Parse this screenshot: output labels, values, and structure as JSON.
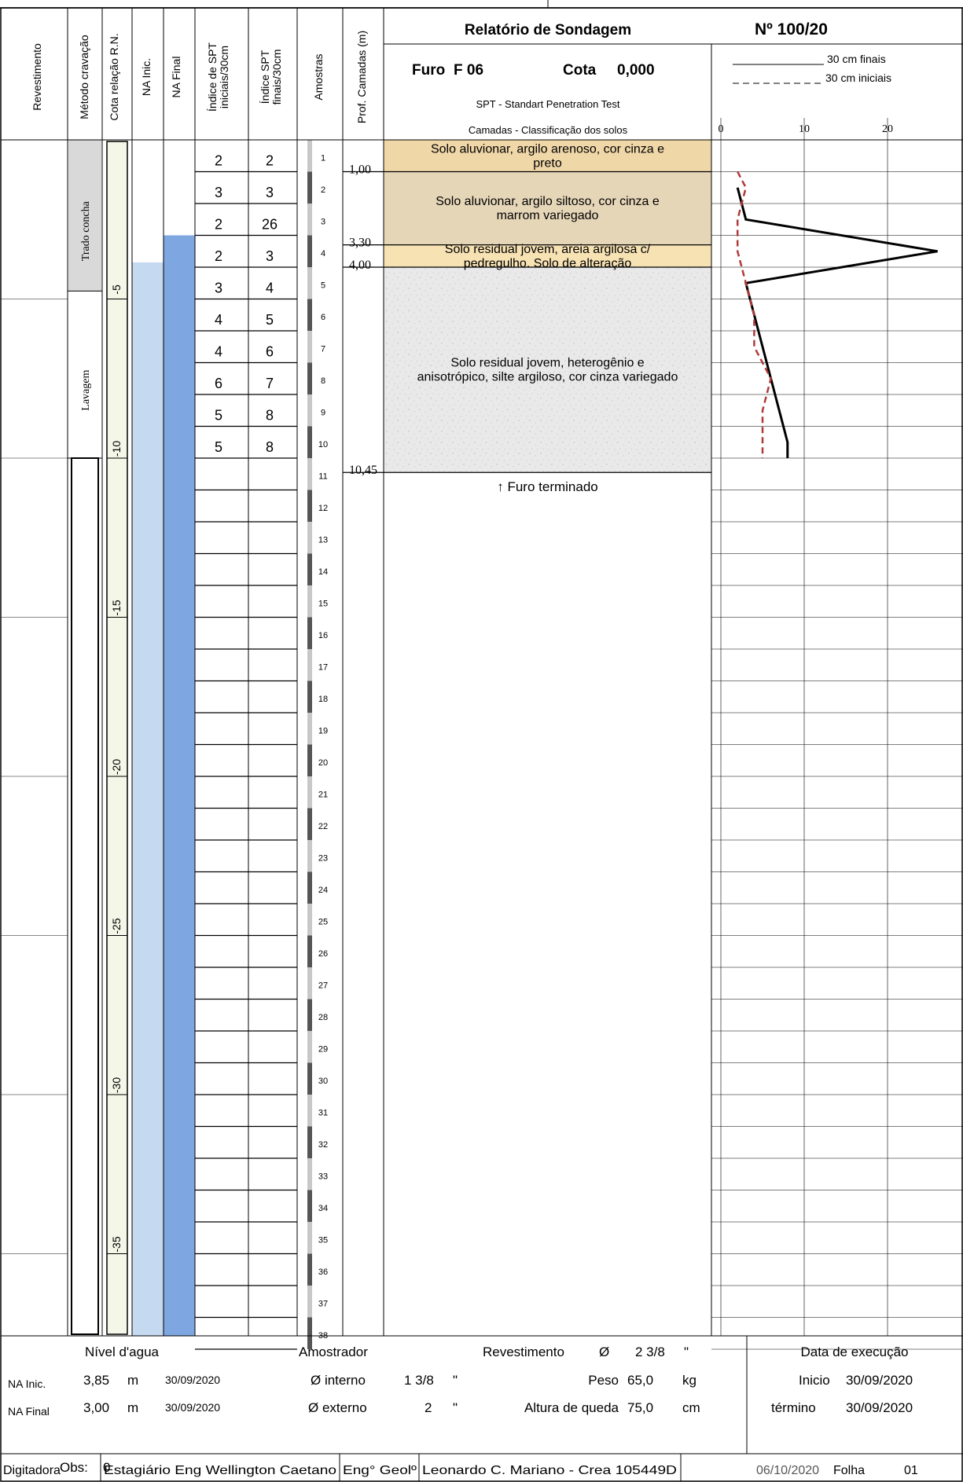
{
  "header": {
    "title": "Relatório de Sondagem",
    "number": "Nº 100/20",
    "furo_label": "Furo",
    "furo_value": "F 06",
    "cota_label": "Cota",
    "cota_value": "0,000",
    "spt_title": "SPT - Standart Penetration Test",
    "layers_title": "Camadas - Classificação dos solos",
    "legend_final": "30 cm finais",
    "legend_initial": "30 cm iniciais",
    "col_revestimento": "Revestimento",
    "col_metodo": "Método cravação",
    "col_cota": "Cota relação R.N.",
    "col_na_inic": "NA Inic.",
    "col_na_final": "NA Final",
    "col_spt_inic_1": "Índice de SPT",
    "col_spt_inic_2": "iniciais/30cm",
    "col_spt_final_1": "Índice SPT",
    "col_spt_final_2": "finais/30cm",
    "col_amostras": "Amostras",
    "col_prof": "Prof. Camadas (m)"
  },
  "methods": [
    {
      "label": "Trado concha",
      "from": 0,
      "to": 4.75
    },
    {
      "label": "Lavagem",
      "from": 4.75,
      "to": 10.0
    }
  ],
  "cota_marks": [
    {
      "label": "-5",
      "depth": 5
    },
    {
      "label": "-10",
      "depth": 10
    },
    {
      "label": "-15",
      "depth": 15
    },
    {
      "label": "-20",
      "depth": 20
    },
    {
      "label": "-25",
      "depth": 25
    },
    {
      "label": "-30",
      "depth": 30
    },
    {
      "label": "-35",
      "depth": 35
    }
  ],
  "water": {
    "na_inic_depth": 3.85,
    "na_final_depth": 3.0
  },
  "spt": [
    {
      "n": "1",
      "inicial": "2",
      "final": "2"
    },
    {
      "n": "2",
      "inicial": "3",
      "final": "3"
    },
    {
      "n": "3",
      "inicial": "2",
      "final": "26"
    },
    {
      "n": "4",
      "inicial": "2",
      "final": "3"
    },
    {
      "n": "5",
      "inicial": "3",
      "final": "4"
    },
    {
      "n": "6",
      "inicial": "4",
      "final": "5"
    },
    {
      "n": "7",
      "inicial": "4",
      "final": "6"
    },
    {
      "n": "8",
      "inicial": "6",
      "final": "7"
    },
    {
      "n": "9",
      "inicial": "5",
      "final": "8"
    },
    {
      "n": "10",
      "inicial": "5",
      "final": "8"
    }
  ],
  "total_meters": 38,
  "layers": [
    {
      "top": 0,
      "bottom": 1.0,
      "depth_label": "1,00",
      "description": [
        "Solo aluvionar, argilo arenoso, cor cinza e",
        "preto"
      ],
      "color": "#f0d7a8"
    },
    {
      "top": 1.0,
      "bottom": 3.3,
      "depth_label": "3,30",
      "description": [
        "Solo aluvionar, argilo siltoso, cor cinza e",
        "marrom variegado"
      ],
      "color": "#e6d6b8"
    },
    {
      "top": 3.3,
      "bottom": 4.0,
      "depth_label": "4,00",
      "description": [
        "Solo residual jovem, areia argilosa c/",
        "pedregulho. Solo de alteração"
      ],
      "color": "#f7e2b4"
    },
    {
      "top": 4.0,
      "bottom": 10.45,
      "depth_label": "10,45",
      "description": [
        "Solo residual jovem, heterogênio e",
        "anisotrópico, silte argiloso, cor cinza variegado"
      ],
      "color": "#e8e8e8"
    }
  ],
  "end_note": "↑ Furo terminado",
  "chart_data": {
    "type": "line",
    "x_axis_ticks": [
      "0",
      "10",
      "20"
    ],
    "xlim": [
      0,
      30
    ],
    "depth_axis": "Prof. (m)",
    "series": [
      {
        "name": "30 cm finais",
        "style": "solid",
        "color": "#000000",
        "points": [
          [
            2,
            1.5
          ],
          [
            3,
            2.5
          ],
          [
            26,
            3.5
          ],
          [
            3,
            4.5
          ],
          [
            4,
            5.5
          ],
          [
            5,
            6.5
          ],
          [
            6,
            7.5
          ],
          [
            7,
            8.5
          ],
          [
            8,
            9.5
          ],
          [
            8,
            10.0
          ]
        ]
      },
      {
        "name": "30 cm iniciais",
        "style": "dashed",
        "color": "#b03a3a",
        "points": [
          [
            2,
            1.0
          ],
          [
            3,
            1.5
          ],
          [
            2,
            2.5
          ],
          [
            2,
            3.5
          ],
          [
            3,
            4.5
          ],
          [
            4,
            5.5
          ],
          [
            4,
            6.5
          ],
          [
            6,
            7.5
          ],
          [
            5,
            8.5
          ],
          [
            5,
            9.5
          ],
          [
            5,
            10.0
          ]
        ]
      }
    ]
  },
  "footer": {
    "nivel_title": "Nível d'agua",
    "na_inic_label": "NA Inic.",
    "na_inic_value": "3,85",
    "na_inic_unit": "m",
    "na_inic_date": "30/09/2020",
    "na_final_label": "NA Final",
    "na_final_value": "3,00",
    "na_final_unit": "m",
    "na_final_date": "30/09/2020",
    "amostrador_title": "Amostrador",
    "interno_label": "Ø interno",
    "interno_value": "1 3/8",
    "interno_unit": "\"",
    "externo_label": "Ø externo",
    "externo_value": "2",
    "externo_unit": "\"",
    "revest_label": "Revestimento",
    "revest_symbol": "Ø",
    "revest_value": "2 3/8",
    "revest_unit": "\"",
    "peso_label": "Peso",
    "peso_value": "65,0",
    "peso_unit": "kg",
    "altura_label": "Altura de queda",
    "altura_value": "75,0",
    "altura_unit": "cm",
    "data_title": "Data de execução",
    "inicio_label": "Inicio",
    "inicio_value": "30/09/2020",
    "termino_label": "término",
    "termino_value": "30/09/2020",
    "obs_label": "Obs:",
    "obs_value": "0",
    "digitadora_label": "Digitadora",
    "digitadora_value": "Estagiário Eng Wellington Caetano",
    "eng_label": "Eng° Geolº",
    "eng_value": "Leonardo C. Mariano - Crea 105449D",
    "date_value": "06/10/2020",
    "folha_label": "Folha",
    "folha_value": "01"
  }
}
